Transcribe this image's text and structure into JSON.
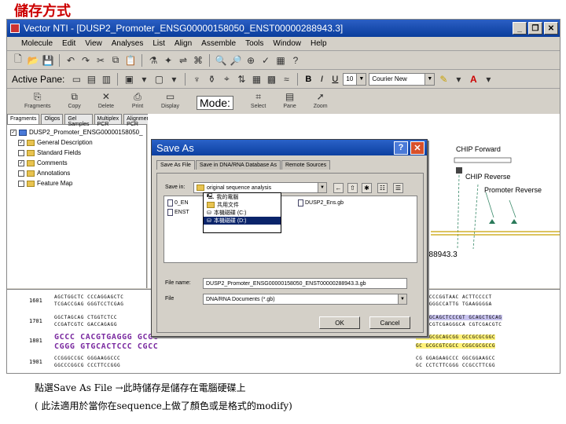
{
  "slide_title": "儲存方式",
  "window": {
    "title": "Vector NTI - [DUSP2_Promoter_ENSG00000158050_ENST00000288943.3]"
  },
  "menu": {
    "items": [
      "Molecule",
      "Edit",
      "View",
      "Analyses",
      "List",
      "Align",
      "Assemble",
      "Tools",
      "Window",
      "Help"
    ]
  },
  "format_toolbar": {
    "active_pane_label": "Active Pane:",
    "font_size": "10",
    "font_name": "Courier New",
    "bold": "B",
    "italic": "I",
    "underline": "U"
  },
  "big_toolbar": {
    "mode_label": "Mode:",
    "items": [
      "Fragments",
      "Copy",
      "Delete",
      "Print",
      "Display",
      "Select",
      "Pane",
      "Zoom"
    ]
  },
  "left_tabs": [
    "Fragments",
    "Oligos",
    "Gel Samples",
    "Multiplex PCR",
    "Alignment PCR"
  ],
  "tree": {
    "root": "DUSP2_Promoter_ENSG00000158050_",
    "children": [
      "General Description",
      "Standard Fields",
      "Comments",
      "Annotations",
      "Feature Map"
    ]
  },
  "map_annotations": {
    "chip_forward": "CHIP Forward",
    "chip_reverse": "CHIP Reverse",
    "promoter_reverse": "Promoter Reverse",
    "coord": "288943.3"
  },
  "sequence": {
    "rows": [
      {
        "num": "1601",
        "top": "AGCTGGCTC CCCAGGAGCTC",
        "bottom": "TCGACCGAG GGGTCCTCGAG",
        "right_top": "CC TCCCGGTAAC ACTTCCCCT",
        "right_bottom": "GG AGGGCCATTG TGAAGGGGA"
      },
      {
        "num": "1701",
        "top": "GGCTAGCAG CTGGTCTCC",
        "bottom": "CCGATCGTC GACCAGAGG",
        "right_top": "GC CGCAGCTCCCGT GCAGCTGCAG",
        "right_bottom": "CG GCGTCGAGGGCA CGTCGACGTC"
      },
      {
        "num": "1801",
        "top": "GCCC CACGTGAGGG GCGG",
        "bottom": "CGGG GTGCACTCCC CGCC",
        "right_top": "CG CGCGCAGCGG GCCGCGCGGC",
        "right_bottom": "GC GCGCGTCGCC CGGCGCGCCG"
      },
      {
        "num": "1901",
        "top": "CCGGGCCGC GGGAAGGCCC",
        "bottom": "GGCCCGGCG CCCTTCCGGG",
        "right_top": "CG GGAGAAGCCC GGCGGAAGCC",
        "right_bottom": "GC CCTCTTCGGG CCGCCTTCGG"
      }
    ]
  },
  "dialog": {
    "title": "Save As",
    "tabs": [
      "Save As File",
      "Save in DNA/RNA Database As",
      "Remote Sources"
    ],
    "save_in_label": "Save in:",
    "save_in_value": "original sequence analysis",
    "dropdown_items": [
      "我的電腦",
      "共用文件",
      "本機磁碟 (C:)",
      "本機磁碟 (D:)"
    ],
    "files": [
      "0_EN",
      "ENST",
      "DUSP2_Ens.gb"
    ],
    "file_name_label": "File name:",
    "file_name_value": "DUSP2_Promoter_ENSG00000158050_ENST00000288943.3.gb",
    "file_type_label": "File",
    "file_type_value": "DNA/RNA Documents (*.gb)",
    "ok": "OK",
    "cancel": "Cancel"
  },
  "caption": {
    "line1": "點選Save As File →此時儲存是儲存在電腦硬碟上",
    "line2": "( 此法適用於當你在sequence上做了顏色或是格式的modify)"
  }
}
